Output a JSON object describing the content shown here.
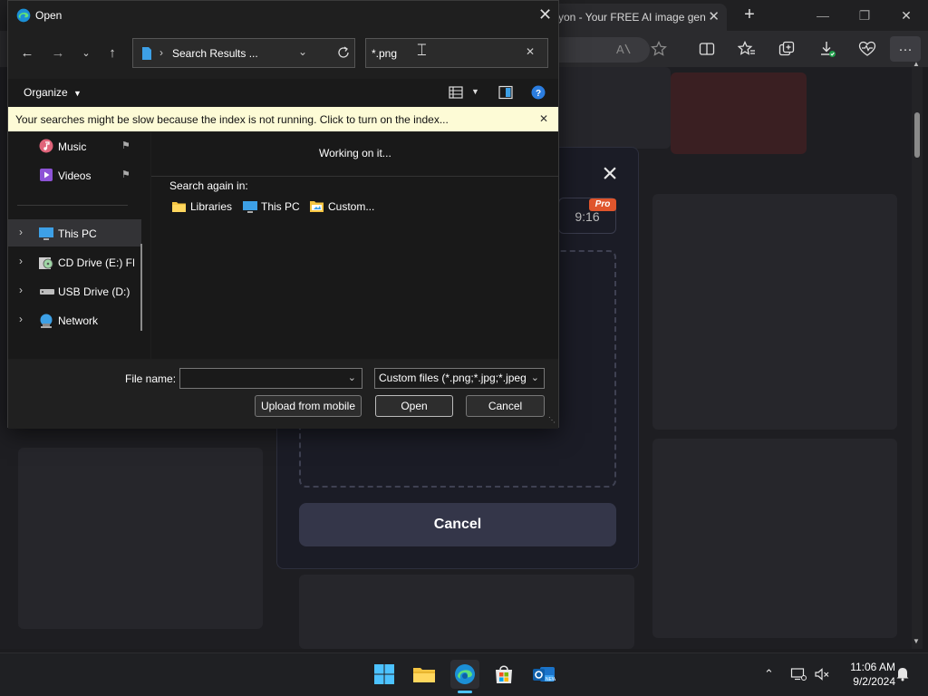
{
  "browser": {
    "tab_title": "yon - Your FREE AI image gen",
    "tab_close": "✕",
    "new_tab": "+",
    "read_aloud": "A̷"
  },
  "site": {
    "ratio_label": "9:16",
    "pro_badge": "Pro",
    "cancel_label": "Cancel"
  },
  "dialog": {
    "title": "Open",
    "path_label": "Search Results ...",
    "search_value": "*.png",
    "organize_label": "Organize",
    "info_message": "Your searches might be slow because the index is not running.  Click to turn on the index...",
    "nav_items": [
      {
        "label": "Music"
      },
      {
        "label": "Videos"
      },
      {
        "label": "This PC"
      },
      {
        "label": "CD Drive (E:) FR"
      },
      {
        "label": "USB Drive (D:)"
      },
      {
        "label": "Network"
      }
    ],
    "working_text": "Working on it...",
    "search_again_label": "Search again in:",
    "search_again_items": [
      {
        "label": "Libraries"
      },
      {
        "label": "This PC"
      },
      {
        "label": "Custom..."
      }
    ],
    "file_name_label": "File name:",
    "file_name_value": "",
    "file_type_value": "Custom files (*.png;*.jpg;*.jpeg",
    "upload_mobile_label": "Upload from mobile",
    "open_label": "Open",
    "cancel_label": "Cancel"
  },
  "taskbar": {
    "time": "11:06 AM",
    "date": "9/2/2024"
  },
  "colors": {
    "accent": "#4cc2ff",
    "info_bar": "#fdfbd6",
    "pro_badge": "#e0552c",
    "modal_bg": "#1b1c26"
  }
}
